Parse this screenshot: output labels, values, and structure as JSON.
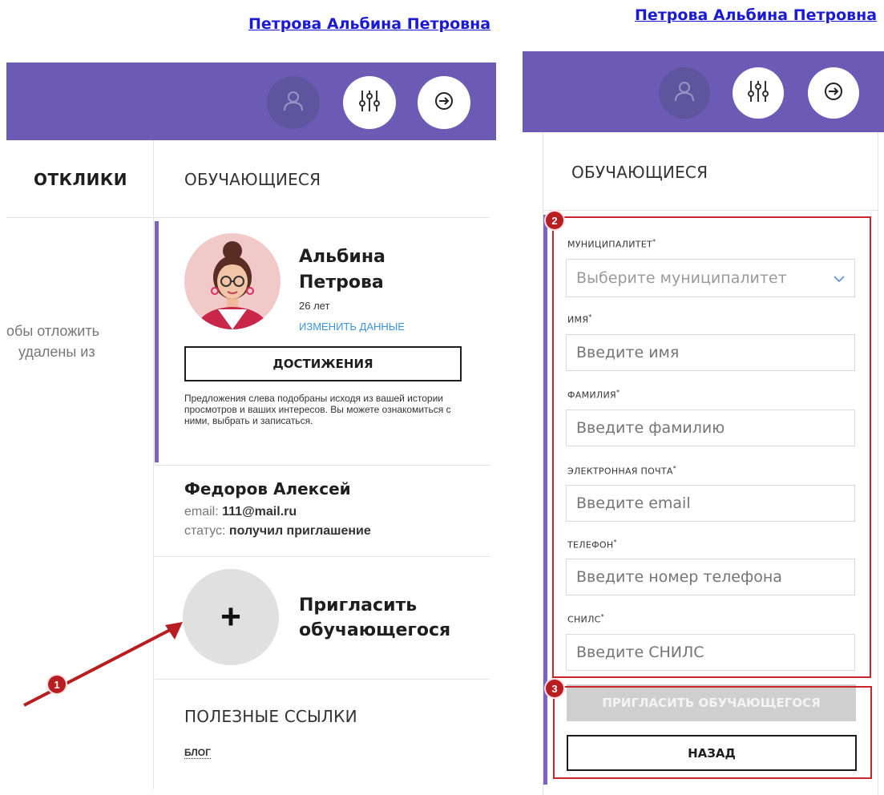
{
  "user_name": "Петрова Альбина Петровна",
  "colors": {
    "header": "#6b5bb4",
    "accent": "#7c64c4",
    "annotation": "#c8262b",
    "link": "#1a1ad6"
  },
  "header_icons": [
    "user-icon",
    "filter-sliders-icon",
    "logout-arrow-icon"
  ],
  "left": {
    "tabs": {
      "responses": "ОТКЛИКИ",
      "students": "ОБУЧАЮЩИЕСЯ"
    },
    "hint_line1": "обы отложить",
    "hint_line2": "удалены из",
    "profile": {
      "first_name": "Альбина",
      "last_name": "Петрова",
      "age": "26 лет",
      "edit_link": "ИЗМЕНИТЬ ДАННЫЕ",
      "achievements": "ДОСТИЖЕНИЯ",
      "description": "Предложения слева подобраны исходя из вашей истории просмотров и ваших интересов. Вы можете ознакомиться с ними, выбрать и записаться."
    },
    "student": {
      "name": "Федоров Алексей",
      "email_label": "email:",
      "email_value": "111@mail.ru",
      "status_label": "статус:",
      "status_value": "получил приглашение"
    },
    "invite": {
      "plus": "+",
      "line1": "Пригласить",
      "line2": "обучающегося"
    },
    "useful": {
      "title": "ПОЛЕЗНЫЕ ССЫЛКИ",
      "blog": "БЛОГ"
    }
  },
  "right": {
    "tab": "ОБУЧАЮЩИЕСЯ",
    "form": {
      "municipality": {
        "label": "МУНИЦИПАЛИТЕТ",
        "placeholder": "Выберите муниципалитет"
      },
      "name": {
        "label": "ИМЯ",
        "placeholder": "Введите имя"
      },
      "surname": {
        "label": "ФАМИЛИЯ",
        "placeholder": "Введите фамилию"
      },
      "email": {
        "label": "ЭЛЕКТРОННАЯ ПОЧТА",
        "placeholder": "Введите email"
      },
      "phone": {
        "label": "ТЕЛЕФОН",
        "placeholder": "Введите номер телефона"
      },
      "snils": {
        "label": "СНИЛС",
        "placeholder": "Введите СНИЛС"
      },
      "required_mark": "*"
    },
    "invite_button": "ПРИГЛАСИТЬ ОБУЧАЮЩЕГОСЯ",
    "back_button": "НАЗАД"
  },
  "annotations": {
    "b1": "1",
    "b2": "2",
    "b3": "3"
  }
}
